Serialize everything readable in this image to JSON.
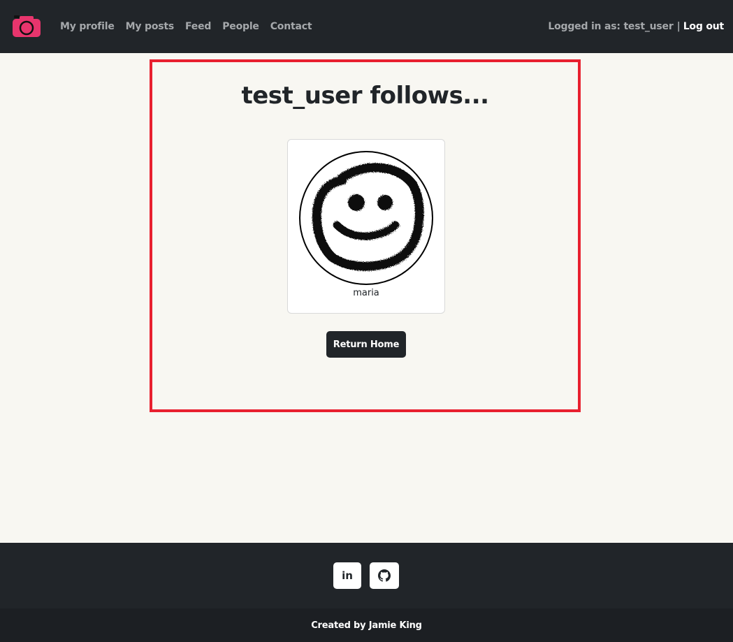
{
  "navbar": {
    "logo_icon": "camera-icon",
    "brand_color": "#e8356d",
    "links": [
      {
        "label": "My profile"
      },
      {
        "label": "My posts"
      },
      {
        "label": "Feed"
      },
      {
        "label": "People"
      },
      {
        "label": "Contact"
      }
    ],
    "logged_in_text": "Logged in as: test_user",
    "separator": "|",
    "logout_label": "Log out"
  },
  "main": {
    "title": "test_user follows...",
    "accent_border_color": "#e8202f",
    "following": [
      {
        "username": "maria",
        "avatar_icon": "smiley-face-icon"
      }
    ],
    "return_button_label": "Return Home"
  },
  "footer": {
    "social": [
      {
        "icon": "linkedin-icon",
        "label": "in"
      },
      {
        "icon": "github-icon"
      }
    ],
    "copyright": "Created by Jamie King"
  }
}
